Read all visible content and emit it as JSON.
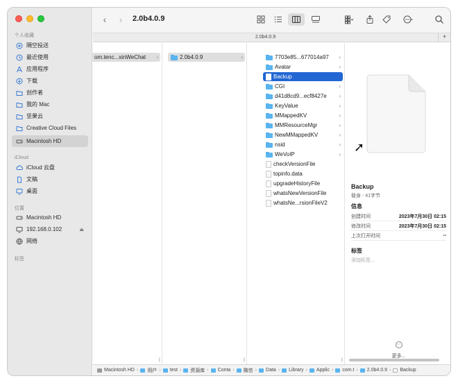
{
  "window": {
    "title": "2.0b4.0.9"
  },
  "sidebar": {
    "favorites_label": "个人收藏",
    "favorites": [
      {
        "label": "隔空投送",
        "icon": "airdrop-icon"
      },
      {
        "label": "最近使用",
        "icon": "clock-icon"
      },
      {
        "label": "应用程序",
        "icon": "apps-icon"
      },
      {
        "label": "下载",
        "icon": "download-icon"
      },
      {
        "label": "创作者",
        "icon": "folder-icon"
      },
      {
        "label": "我的 Mac",
        "icon": "folder-icon"
      },
      {
        "label": "坚果云",
        "icon": "folder-icon"
      },
      {
        "label": "Creative Cloud Files",
        "icon": "folder-icon"
      },
      {
        "label": "Macintosh HD",
        "icon": "drive-icon"
      }
    ],
    "icloud_label": "iCloud",
    "icloud": [
      {
        "label": "iCloud 云盘",
        "icon": "cloud-icon"
      },
      {
        "label": "文稿",
        "icon": "document-icon"
      },
      {
        "label": "桌面",
        "icon": "desktop-icon"
      }
    ],
    "locations_label": "位置",
    "locations": [
      {
        "label": "Macintosh HD",
        "icon": "drive-icon"
      },
      {
        "label": "192.168.0.102",
        "icon": "display-icon"
      },
      {
        "label": "网络",
        "icon": "network-icon"
      }
    ],
    "tags_label": "标签"
  },
  "path_location": "2.0b4.0.9",
  "columns": {
    "col1": [
      {
        "label": "om.tenc...xinWeChat"
      }
    ],
    "col2": [
      {
        "label": "2.0b4.0.9"
      }
    ],
    "col3": [
      {
        "label": "7703e85...677014a97",
        "kind": "folder"
      },
      {
        "label": "Avatar",
        "kind": "folder"
      },
      {
        "label": "Backup",
        "kind": "alias"
      },
      {
        "label": "CGI",
        "kind": "folder"
      },
      {
        "label": "d41d8cd9...ecf8427e",
        "kind": "folder"
      },
      {
        "label": "KeyValue",
        "kind": "folder"
      },
      {
        "label": "MMappedKV",
        "kind": "folder"
      },
      {
        "label": "MMResourceMgr",
        "kind": "folder"
      },
      {
        "label": "NewMMappedKV",
        "kind": "folder"
      },
      {
        "label": "nsid",
        "kind": "folder"
      },
      {
        "label": "WeVoIP",
        "kind": "folder"
      },
      {
        "label": "checkVersionFile",
        "kind": "file"
      },
      {
        "label": "topinfo.data",
        "kind": "file"
      },
      {
        "label": "upgradeHistoryFile",
        "kind": "file"
      },
      {
        "label": "whatsNewVersionFile",
        "kind": "file"
      },
      {
        "label": "whatsNe...rsionFileV2",
        "kind": "file"
      }
    ]
  },
  "preview": {
    "name": "Backup",
    "subtitle": "替身 - 41字节",
    "info_heading": "信息",
    "info": [
      {
        "label": "创建时间",
        "value": "2023年7月30日 02:15"
      },
      {
        "label": "修改时间",
        "value": "2023年7月30日 02:15"
      },
      {
        "label": "上次打开时间",
        "value": "--"
      }
    ],
    "tags_heading": "标签",
    "tags_placeholder": "添加标签...",
    "more_label": "更多..."
  },
  "statusbar": {
    "crumbs": [
      "Macintosh HD",
      "用户",
      "test",
      "资源库",
      "Conta",
      "微信",
      "Data",
      "Library",
      "Applic",
      "com.t",
      "2.0b4.0.9",
      "Backup"
    ]
  }
}
